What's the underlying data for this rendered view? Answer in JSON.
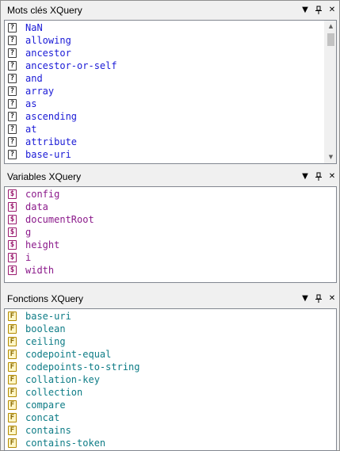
{
  "panes": [
    {
      "title": "Mots clés XQuery",
      "icon_letter": "?",
      "text_color": "#1a1ad6",
      "items": [
        "NaN",
        "allowing",
        "ancestor",
        "ancestor-or-self",
        "and",
        "array",
        "as",
        "ascending",
        "at",
        "attribute",
        "base-uri"
      ],
      "scroll": {
        "up_arrow": "▲",
        "down_arrow": "▼"
      }
    },
    {
      "title": "Variables XQuery",
      "icon_letter": "$",
      "text_color": "#8b1a8b",
      "items": [
        "config",
        "data",
        "documentRoot",
        "g",
        "height",
        "i",
        "width"
      ]
    },
    {
      "title": "Fonctions XQuery",
      "icon_letter": "F",
      "text_color": "#0e7c86",
      "items": [
        "base-uri",
        "boolean",
        "ceiling",
        "codepoint-equal",
        "codepoints-to-string",
        "collation-key",
        "collection",
        "compare",
        "concat",
        "contains",
        "contains-token"
      ]
    }
  ],
  "titlebar_buttons": {
    "dropdown": "▼",
    "pin": "🖈",
    "close": "✕"
  }
}
